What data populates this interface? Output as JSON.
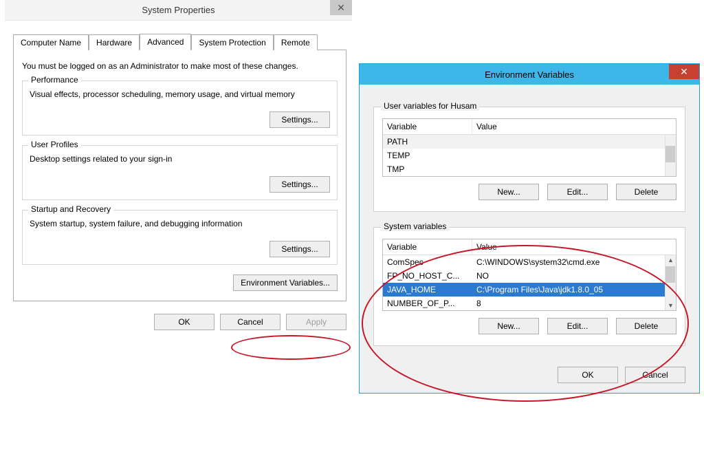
{
  "sys": {
    "title": "System Properties",
    "tabs": [
      "Computer Name",
      "Hardware",
      "Advanced",
      "System Protection",
      "Remote"
    ],
    "active_tab_index": 2,
    "admin_note": "You must be logged on as an Administrator to make most of these changes.",
    "groups": {
      "performance": {
        "title": "Performance",
        "desc": "Visual effects, processor scheduling, memory usage, and virtual memory",
        "settings_label": "Settings..."
      },
      "profiles": {
        "title": "User Profiles",
        "desc": "Desktop settings related to your sign-in",
        "settings_label": "Settings..."
      },
      "startup": {
        "title": "Startup and Recovery",
        "desc": "System startup, system failure, and debugging information",
        "settings_label": "Settings..."
      }
    },
    "env_var_btn": "Environment Variables...",
    "ok": "OK",
    "cancel": "Cancel",
    "apply": "Apply"
  },
  "env": {
    "title": "Environment Variables",
    "user_title": "User variables for Husam",
    "sys_title": "System variables",
    "col_variable": "Variable",
    "col_value": "Value",
    "user_rows": [
      {
        "name": "PATH",
        "value": ""
      },
      {
        "name": "TEMP",
        "value": ""
      },
      {
        "name": "TMP",
        "value": ""
      }
    ],
    "sys_rows": [
      {
        "name": "ComSpec",
        "value": "C:\\WINDOWS\\system32\\cmd.exe"
      },
      {
        "name": "FP_NO_HOST_C...",
        "value": "NO"
      },
      {
        "name": "JAVA_HOME",
        "value": "C:\\Program Files\\Java\\jdk1.8.0_05"
      },
      {
        "name": "NUMBER_OF_P...",
        "value": "8"
      }
    ],
    "sys_selected_index": 2,
    "user_light_selected_index": 0,
    "new": "New...",
    "edit": "Edit...",
    "delete": "Delete",
    "ok": "OK",
    "cancel": "Cancel"
  }
}
